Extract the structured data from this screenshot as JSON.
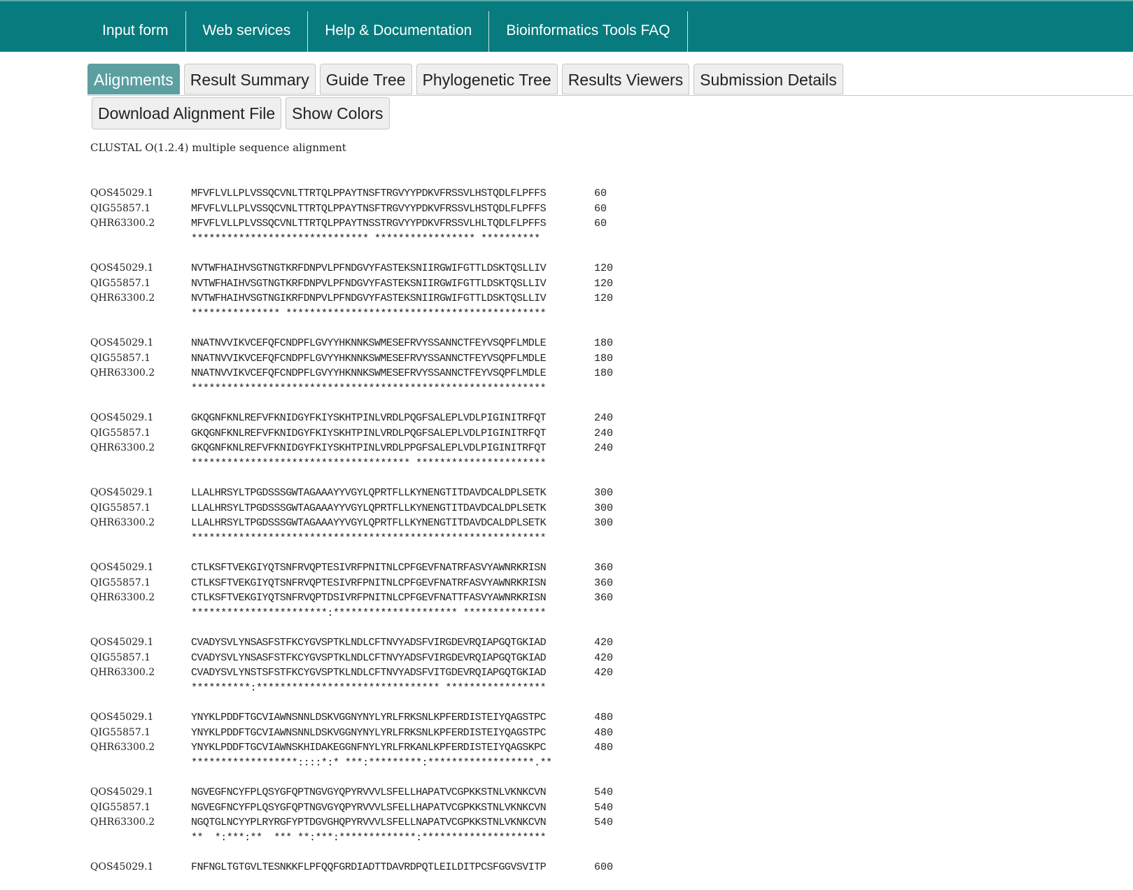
{
  "nav": {
    "items": [
      "Input form",
      "Web services",
      "Help & Documentation",
      "Bioinformatics Tools FAQ"
    ]
  },
  "tabs": {
    "items": [
      "Alignments",
      "Result Summary",
      "Guide Tree",
      "Phylogenetic Tree",
      "Results Viewers",
      "Submission Details"
    ],
    "active": "Alignments"
  },
  "actions": {
    "download_label": "Download Alignment File",
    "colors_label": "Show Colors"
  },
  "alignment": {
    "header": "CLUSTAL O(1.2.4) multiple sequence alignment",
    "blocks": [
      {
        "rows": [
          {
            "id": "QOS45029.1",
            "seq": "MFVFLVLLPLVSSQCVNLTTRTQLPPAYTNSFTRGVYYPDKVFRSSVLHSTQDLFLPFFS",
            "pos": "60"
          },
          {
            "id": "QIG55857.1",
            "seq": "MFVFLVLLPLVSSQCVNLTTRTQLPPAYTNSFTRGVYYPDKVFRSSVLHSTQDLFLPFFS",
            "pos": "60"
          },
          {
            "id": "QHR63300.2",
            "seq": "MFVFLVLLPLVSSQCVNLTTRTQLPPAYTNSSTRGVYYPDKVFRSSVLHLTQDLFLPFFS",
            "pos": "60"
          }
        ],
        "consensus": "****************************** ***************** **********"
      },
      {
        "rows": [
          {
            "id": "QOS45029.1",
            "seq": "NVTWFHAIHVSGTNGTKRFDNPVLPFNDGVYFASTEKSNIIRGWIFGTTLDSKTQSLLIV",
            "pos": "120"
          },
          {
            "id": "QIG55857.1",
            "seq": "NVTWFHAIHVSGTNGTKRFDNPVLPFNDGVYFASTEKSNIIRGWIFGTTLDSKTQSLLIV",
            "pos": "120"
          },
          {
            "id": "QHR63300.2",
            "seq": "NVTWFHAIHVSGTNGIKRFDNPVLPFNDGVYFASTEKSNIIRGWIFGTTLDSKTQSLLIV",
            "pos": "120"
          }
        ],
        "consensus": "*************** ********************************************"
      },
      {
        "rows": [
          {
            "id": "QOS45029.1",
            "seq": "NNATNVVIKVCEFQFCNDPFLGVYYHKNNKSWMESEFRVYSSANNCTFEYVSQPFLMDLE",
            "pos": "180"
          },
          {
            "id": "QIG55857.1",
            "seq": "NNATNVVIKVCEFQFCNDPFLGVYYHKNNKSWMESEFRVYSSANNCTFEYVSQPFLMDLE",
            "pos": "180"
          },
          {
            "id": "QHR63300.2",
            "seq": "NNATNVVIKVCEFQFCNDPFLGVYYHKNNKSWMESEFRVYSSANNCTFEYVSQPFLMDLE",
            "pos": "180"
          }
        ],
        "consensus": "************************************************************"
      },
      {
        "rows": [
          {
            "id": "QOS45029.1",
            "seq": "GKQGNFKNLREFVFKNIDGYFKIYSKHTPINLVRDLPQGFSALEPLVDLPIGINITRFQT",
            "pos": "240"
          },
          {
            "id": "QIG55857.1",
            "seq": "GKQGNFKNLREFVFKNIDGYFKIYSKHTPINLVRDLPQGFSALEPLVDLPIGINITRFQT",
            "pos": "240"
          },
          {
            "id": "QHR63300.2",
            "seq": "GKQGNFKNLREFVFKNIDGYFKIYSKHTPINLVRDLPPGFSALEPLVDLPIGINITRFQT",
            "pos": "240"
          }
        ],
        "consensus": "************************************* **********************"
      },
      {
        "rows": [
          {
            "id": "QOS45029.1",
            "seq": "LLALHRSYLTPGDSSSGWTAGAAAYYVGYLQPRTFLLKYNENGTITDAVDCALDPLSETK",
            "pos": "300"
          },
          {
            "id": "QIG55857.1",
            "seq": "LLALHRSYLTPGDSSSGWTAGAAAYYVGYLQPRTFLLKYNENGTITDAVDCALDPLSETK",
            "pos": "300"
          },
          {
            "id": "QHR63300.2",
            "seq": "LLALHRSYLTPGDSSSGWTAGAAAYYVGYLQPRTFLLKYNENGTITDAVDCALDPLSETK",
            "pos": "300"
          }
        ],
        "consensus": "************************************************************"
      },
      {
        "rows": [
          {
            "id": "QOS45029.1",
            "seq": "CTLKSFTVEKGIYQTSNFRVQPTESIVRFPNITNLCPFGEVFNATRFASVYAWNRKRISN",
            "pos": "360"
          },
          {
            "id": "QIG55857.1",
            "seq": "CTLKSFTVEKGIYQTSNFRVQPTESIVRFPNITNLCPFGEVFNATRFASVYAWNRKRISN",
            "pos": "360"
          },
          {
            "id": "QHR63300.2",
            "seq": "CTLKSFTVEKGIYQTSNFRVQPTDSIVRFPNITNLCPFGEVFNATTFASVYAWNRKRISN",
            "pos": "360"
          }
        ],
        "consensus": "***********************:********************* **************"
      },
      {
        "rows": [
          {
            "id": "QOS45029.1",
            "seq": "CVADYSVLYNSASFSTFKCYGVSPTKLNDLCFTNVYADSFVIRGDEVRQIAPGQTGKIAD",
            "pos": "420"
          },
          {
            "id": "QIG55857.1",
            "seq": "CVADYSVLYNSASFSTFKCYGVSPTKLNDLCFTNVYADSFVIRGDEVRQIAPGQTGKIAD",
            "pos": "420"
          },
          {
            "id": "QHR63300.2",
            "seq": "CVADYSVLYNSTSFSTFKCYGVSPTKLNDLCFTNVYADSFVITGDEVRQIAPGQTGKIAD",
            "pos": "420"
          }
        ],
        "consensus": "**********:******************************* *****************"
      },
      {
        "rows": [
          {
            "id": "QOS45029.1",
            "seq": "YNYKLPDDFTGCVIAWNSNNLDSKVGGNYNYLYRLFRKSNLKPFERDISTEIYQAGSTPC",
            "pos": "480"
          },
          {
            "id": "QIG55857.1",
            "seq": "YNYKLPDDFTGCVIAWNSNNLDSKVGGNYNYLYRLFRKSNLKPFERDISTEIYQAGSTPC",
            "pos": "480"
          },
          {
            "id": "QHR63300.2",
            "seq": "YNYKLPDDFTGCVIAWNSKHIDAKEGGNFNYLYRLFRKANLKPFERDISTEIYQAGSKPC",
            "pos": "480"
          }
        ],
        "consensus": "******************::::*:* ***:*********:******************.**"
      },
      {
        "rows": [
          {
            "id": "QOS45029.1",
            "seq": "NGVEGFNCYFPLQSYGFQPTNGVGYQPYRVVVLSFELLHAPATVCGPKKSTNLVKNKCVN",
            "pos": "540"
          },
          {
            "id": "QIG55857.1",
            "seq": "NGVEGFNCYFPLQSYGFQPTNGVGYQPYRVVVLSFELLHAPATVCGPKKSTNLVKNKCVN",
            "pos": "540"
          },
          {
            "id": "QHR63300.2",
            "seq": "NGQTGLNCYYPLRYRGFYPTDGVGHQPYRVVVLSFELLNAPATVCGPKKSTNLVKNKCVN",
            "pos": "540"
          }
        ],
        "consensus": "**  *:***:**  *** **:***:*************:*********************"
      },
      {
        "rows": [
          {
            "id": "QOS45029.1",
            "seq": "FNFNGLTGTGVLTESNKKFLPFQQFGRDIADTTDAVRDPQTLEILDITPCSFGGVSVITP",
            "pos": "600"
          }
        ],
        "consensus": ""
      }
    ]
  }
}
